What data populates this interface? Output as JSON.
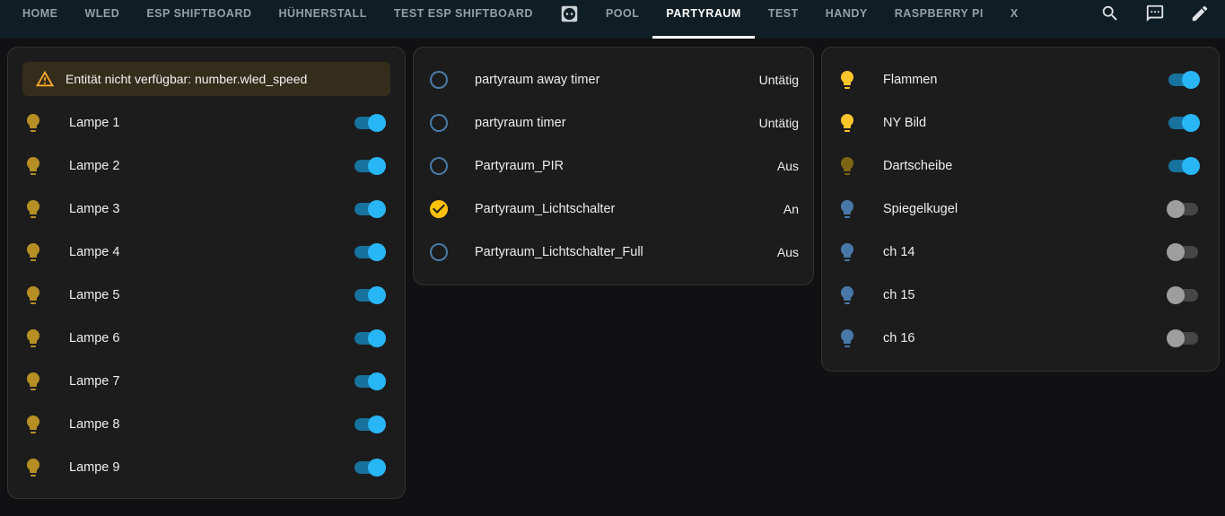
{
  "header": {
    "tabs": [
      {
        "label": "HOME"
      },
      {
        "label": "WLED"
      },
      {
        "label": "ESP SHIFTBOARD"
      },
      {
        "label": "HÜHNERSTALL"
      },
      {
        "label": "TEST ESP SHIFTBOARD"
      },
      {
        "label": "",
        "icon": "power-socket"
      },
      {
        "label": "POOL"
      },
      {
        "label": "PARTYRAUM",
        "active": true
      },
      {
        "label": "TEST"
      },
      {
        "label": "HANDY"
      },
      {
        "label": "RASPBERRY PI"
      },
      {
        "label": "X"
      }
    ],
    "action_icons": [
      "search",
      "chat",
      "edit"
    ]
  },
  "cards": {
    "left": {
      "warning": "Entität nicht verfügbar: number.wled_speed",
      "rows": [
        {
          "name": "Lampe 1",
          "state": "on"
        },
        {
          "name": "Lampe 2",
          "state": "on"
        },
        {
          "name": "Lampe 3",
          "state": "on"
        },
        {
          "name": "Lampe 4",
          "state": "on"
        },
        {
          "name": "Lampe 5",
          "state": "on"
        },
        {
          "name": "Lampe 6",
          "state": "on"
        },
        {
          "name": "Lampe 7",
          "state": "on"
        },
        {
          "name": "Lampe 8",
          "state": "on"
        },
        {
          "name": "Lampe 9",
          "state": "on"
        }
      ]
    },
    "middle": {
      "rows": [
        {
          "name": "partyraum away timer",
          "state": "Untätig",
          "icon": "circle-outline"
        },
        {
          "name": "partyraum timer",
          "state": "Untätig",
          "icon": "circle-outline"
        },
        {
          "name": "Partyraum_PIR",
          "state": "Aus",
          "icon": "circle-outline"
        },
        {
          "name": "Partyraum_Lichtschalter",
          "state": "An",
          "icon": "check-circle"
        },
        {
          "name": "Partyraum_Lichtschalter_Full",
          "state": "Aus",
          "icon": "circle-outline"
        }
      ]
    },
    "right": {
      "rows": [
        {
          "name": "Flammen",
          "state": "on"
        },
        {
          "name": "NY Bild",
          "state": "on"
        },
        {
          "name": "Dartscheibe",
          "state": "on"
        },
        {
          "name": "Spiegelkugel",
          "state": "off"
        },
        {
          "name": "ch 14",
          "state": "off"
        },
        {
          "name": "ch 15",
          "state": "off"
        },
        {
          "name": "ch 16",
          "state": "off"
        }
      ]
    }
  },
  "colors": {
    "header_bg": "#0f1d24",
    "page_bg": "#111113",
    "card_bg": "#1c1c1d",
    "warning_bg": "#352d1c",
    "warning_icon": "#fbab2a",
    "toggle_on_knob": "#29b6f6",
    "toggle_on_track": "#17729d",
    "toggle_off_knob": "#9e9e9e",
    "toggle_off_track": "#464646",
    "bulb_gold": "#b68f24",
    "bulb_bright": "#fdc42c",
    "bulb_dim": "#7d6511",
    "bulb_off_blue": "#4878a8",
    "check_circle": "#ffc107",
    "circle_outline": "#4a7ba7",
    "tab_active": "#ffffff",
    "tab_inactive": "#93a0a6"
  }
}
